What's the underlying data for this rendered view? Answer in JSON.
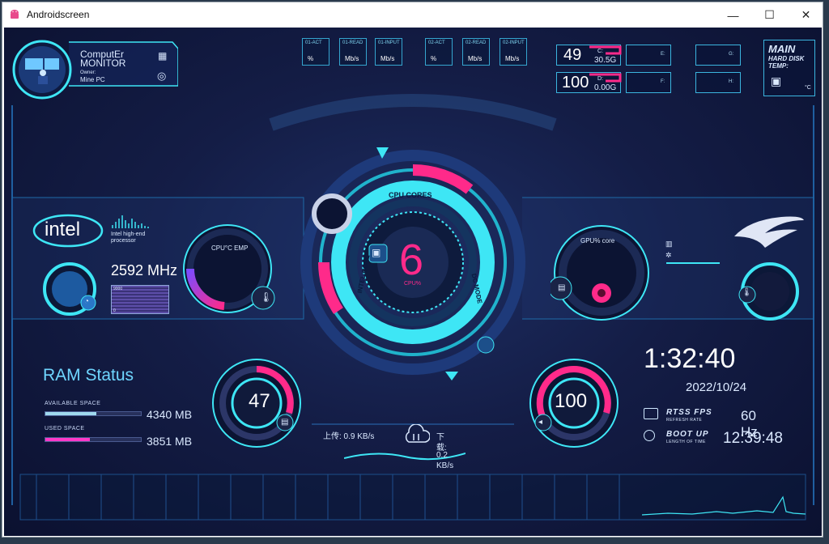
{
  "window": {
    "title": "Androidscreen",
    "minimize": "—",
    "maximize": "☐",
    "close": "✕"
  },
  "header": {
    "brand_line1": "ComputEr",
    "brand_line2": "MONITOR",
    "owner_label": "Owner:",
    "owner_name": "Mine PC"
  },
  "top_indicators": [
    {
      "label": "01-ACT",
      "unit": "%"
    },
    {
      "label": "01-READ",
      "unit": "Mb/s"
    },
    {
      "label": "01-INPUT",
      "unit": "Mb/s"
    },
    {
      "label": "02-ACT",
      "unit": "%"
    },
    {
      "label": "02-READ",
      "unit": "Mb/s"
    },
    {
      "label": "02-INPUT",
      "unit": "Mb/s"
    }
  ],
  "disks": {
    "c": {
      "percent": "49",
      "letter": "C:",
      "free": "30.5G"
    },
    "d": {
      "percent": "100",
      "letter": "D:",
      "free": "0.00G"
    },
    "e": {
      "letter": "E:"
    },
    "f": {
      "letter": "F:"
    },
    "g": {
      "letter": "G:"
    },
    "h": {
      "letter": "H:"
    },
    "main_title": "MAIN",
    "subtitle_1": "HARD DISK",
    "subtitle_2": "TEMP:",
    "temp_unit": "°C"
  },
  "cpu_panel": {
    "brand": "intel",
    "desc_1": "Intel high-end",
    "desc_2": "processor",
    "freq": "2592 MHz",
    "mini_label": "9000",
    "mini_zero": "0",
    "temp_label": "CPU°C EMP"
  },
  "center": {
    "cores": "6",
    "unit": "CPU%",
    "ring_label_top": "CPU CORES",
    "ring_label_left": "INTEL CORE",
    "ring_label_right": "DC MODE"
  },
  "gpu_panel": {
    "label": "GPU% core"
  },
  "ram": {
    "title": "RAM Status",
    "available_label": "AVAILABLE SPACE",
    "available_value": "4340 MB",
    "available_fraction": 0.53,
    "used_label": "USED SPACE",
    "used_value": "3851 MB",
    "used_fraction": 0.47
  },
  "left_gauge": {
    "value": "47"
  },
  "right_gauge": {
    "value": "100"
  },
  "network": {
    "upload": "上传: 0.9 KB/s",
    "download_1": "下",
    "download_2": "载:",
    "download_3": "0.2",
    "download_4": "KB/s"
  },
  "clock": {
    "time": "1:32:40",
    "date": "2022/10/24"
  },
  "stats": {
    "fps_label": "RTSS FPS",
    "fps_sub": "REFRESH RATE",
    "fps_value": "60",
    "hz": "Hz",
    "boot_label": "BOOT UP",
    "boot_sub": "LENGTH OF TIME",
    "boot_value": "12:39:48"
  },
  "colors": {
    "accent": "#3ee6f5",
    "magenta": "#ff2a8a",
    "purple": "#9b3cff",
    "background": "#141d46"
  }
}
